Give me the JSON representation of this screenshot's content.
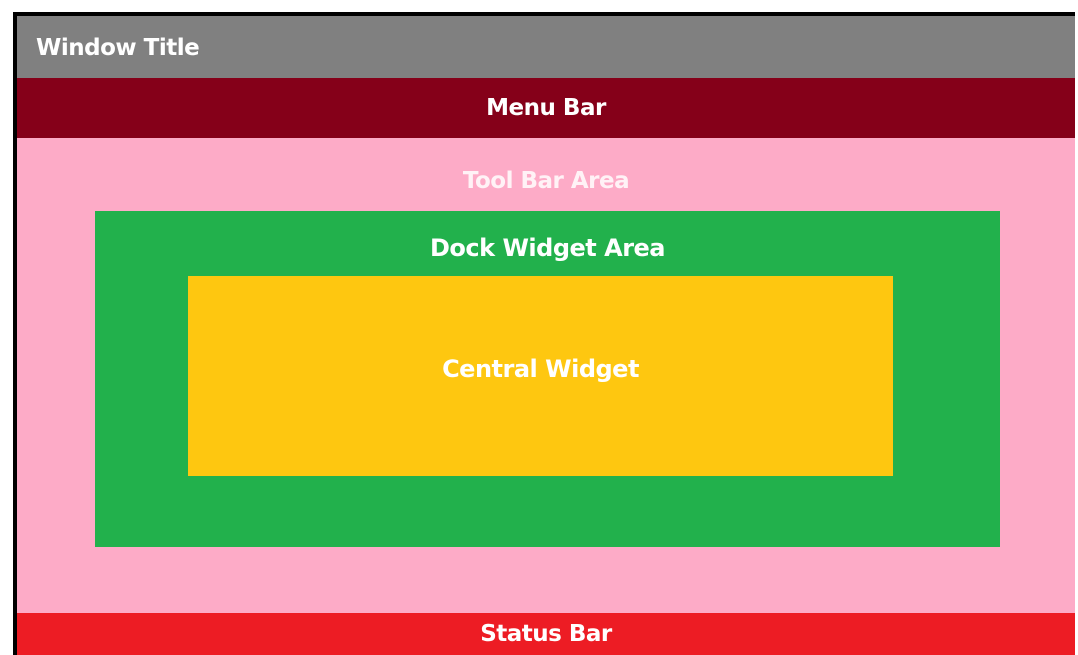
{
  "window": {
    "title": "Window Title"
  },
  "menu_bar": {
    "label": "Menu Bar"
  },
  "toolbar_area": {
    "label": "Tool Bar Area"
  },
  "dock_widget_area": {
    "label": "Dock Widget Area"
  },
  "central_widget": {
    "label": "Central Widget"
  },
  "status_bar": {
    "label": "Status Bar"
  },
  "colors": {
    "title_bar": "#808080",
    "menu_bar": "#850019",
    "toolbar_area": "#fdabc7",
    "dock_widget_area": "#22b14c",
    "central_widget": "#fec710",
    "status_bar": "#ed1c24",
    "border": "#000000"
  }
}
